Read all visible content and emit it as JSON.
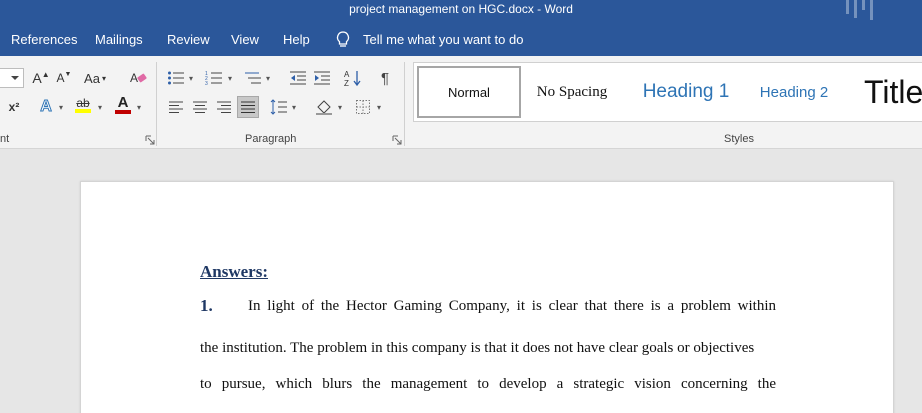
{
  "window": {
    "title": "project management on HGC.docx  -  Word"
  },
  "menu": {
    "tabs": [
      "References",
      "Mailings",
      "Review",
      "View",
      "Help"
    ],
    "tell_me": "Tell me what you want to do"
  },
  "ribbon": {
    "font_group_label": "nt",
    "paragraph_group_label": "Paragraph",
    "styles_group_label": "Styles",
    "font_tools": {
      "grow_font": "A",
      "shrink_font": "A",
      "change_case": "Aa",
      "superscript": "x²",
      "text_effects": "A",
      "highlight": "ab",
      "font_color": "A"
    },
    "highlight_color": "#ffff00",
    "font_color_bar": "#c00000",
    "styles": [
      "Normal",
      "No Spacing",
      "Heading 1",
      "Heading 2",
      "Title"
    ]
  },
  "document": {
    "heading": "Answers:",
    "question_number": "1.",
    "lines": [
      "In light of the Hector Gaming Company, it is clear that there is a problem within",
      "the institution. The problem in this company is that it does not have clear goals or objectives",
      "to pursue, which blurs the management to develop a strategic vision concerning the"
    ]
  },
  "colors": {
    "accent": "#2b579a",
    "heading_blue": "#2e74b5",
    "doc_heading": "#1f3864"
  }
}
